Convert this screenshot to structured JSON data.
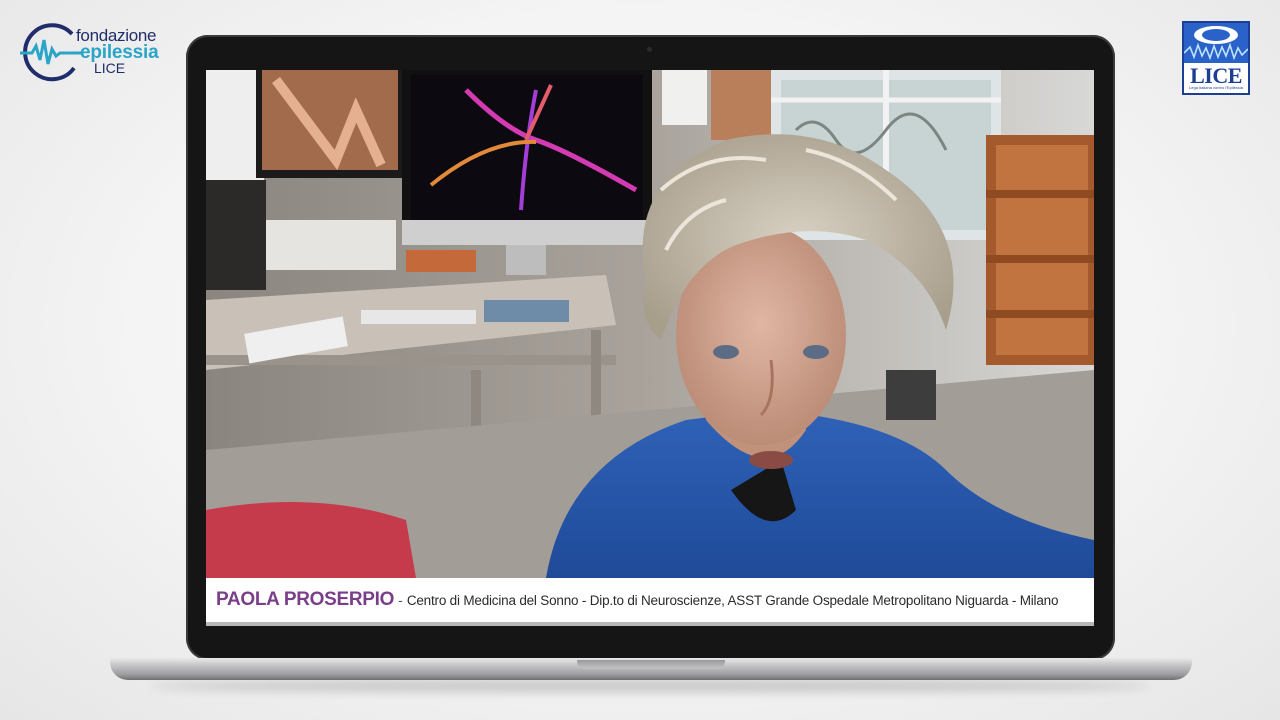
{
  "branding": {
    "left_logo": {
      "line1": "fondazione",
      "line2": "epilessia",
      "line3": "LICE"
    },
    "right_logo": {
      "text": "LICE",
      "subtitle": "Lega Italiana contro l'Epilessia"
    }
  },
  "video": {
    "speaker_name": "PAOLA PROSERPIO",
    "separator": "-",
    "affiliation": "Centro di Medicina del Sonno - Dip.to di Neuroscienze, ASST Grande Ospedale Metropolitano Niguarda - Milano"
  },
  "colors": {
    "name_color": "#7b3f8a",
    "logo_navy": "#1f2d6b",
    "logo_cyan": "#29a5c9",
    "lice_blue": "#1c3f94"
  }
}
